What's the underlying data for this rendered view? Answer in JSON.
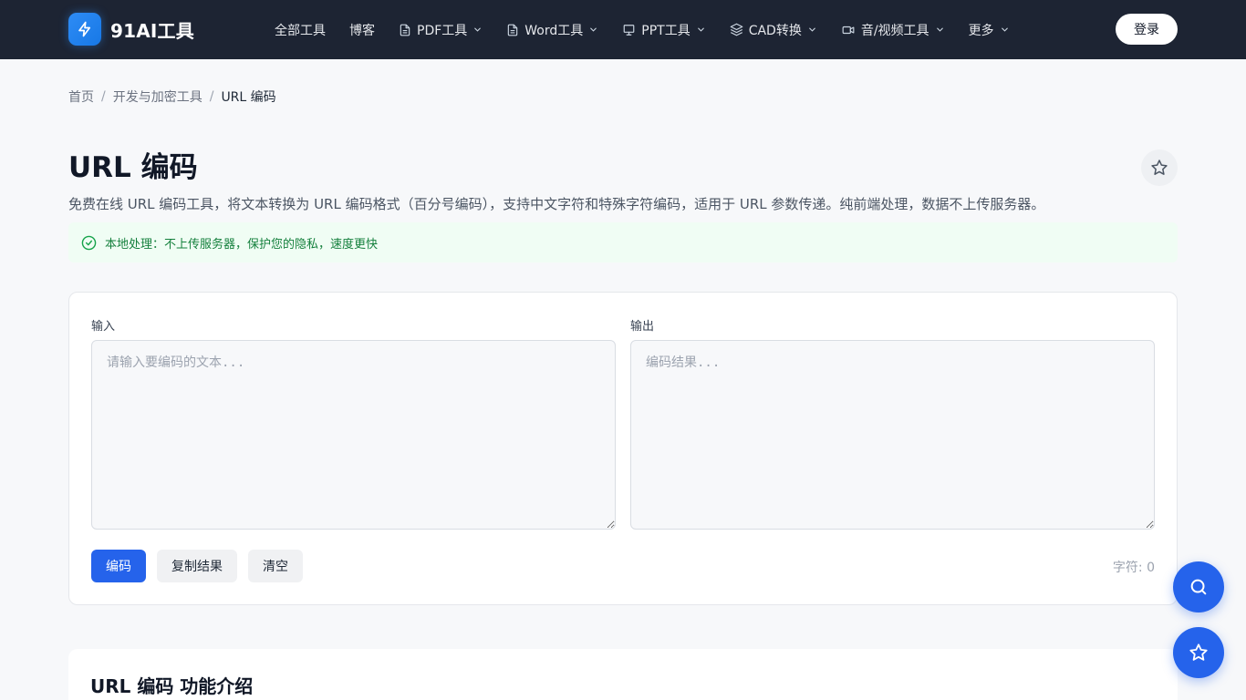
{
  "brand": {
    "name": "91AI工具"
  },
  "nav": {
    "items": [
      {
        "label": "全部工具",
        "icon": "",
        "dropdown": false
      },
      {
        "label": "博客",
        "icon": "",
        "dropdown": false
      },
      {
        "label": "PDF工具",
        "icon": "file-icon",
        "dropdown": true
      },
      {
        "label": "Word工具",
        "icon": "file-icon",
        "dropdown": true
      },
      {
        "label": "PPT工具",
        "icon": "presentation-icon",
        "dropdown": true
      },
      {
        "label": "CAD转换",
        "icon": "layers-icon",
        "dropdown": true
      },
      {
        "label": "音/视频工具",
        "icon": "video-icon",
        "dropdown": true
      },
      {
        "label": "更多",
        "icon": "",
        "dropdown": true
      }
    ],
    "login_label": "登录"
  },
  "breadcrumb": {
    "home": "首页",
    "category": "开发与加密工具",
    "current": "URL 编码"
  },
  "page": {
    "title": "URL 编码",
    "description": "免费在线 URL 编码工具，将文本转换为 URL 编码格式（百分号编码），支持中文字符和特殊字符编码，适用于 URL 参数传递。纯前端处理，数据不上传服务器。",
    "local_note": "本地处理：不上传服务器，保护您的隐私，速度更快"
  },
  "tool": {
    "input_label": "输入",
    "input_placeholder": "请输入要编码的文本...",
    "input_value": "",
    "output_label": "输出",
    "output_placeholder": "编码结果...",
    "output_value": "",
    "encode_label": "编码",
    "copy_label": "复制结果",
    "clear_label": "清空",
    "char_count": "字符: 0"
  },
  "intro": {
    "title": "URL 编码 功能介绍"
  },
  "colors": {
    "accent": "#2563eb",
    "navbar": "#1d2433",
    "success": "#15803d"
  }
}
